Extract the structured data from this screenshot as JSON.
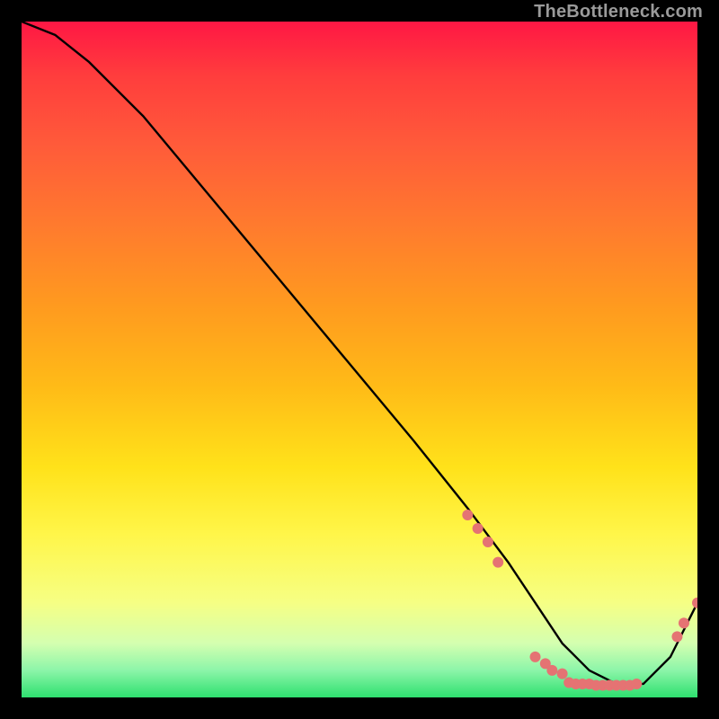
{
  "attribution": "TheBottleneck.com",
  "chart_data": {
    "type": "line",
    "title": "",
    "xlabel": "",
    "ylabel": "",
    "xlim": [
      0,
      100
    ],
    "ylim": [
      0,
      100
    ],
    "background_gradient": [
      "#ff1744",
      "#ff9a1f",
      "#fff64a",
      "#2ee06f"
    ],
    "series": [
      {
        "name": "bottleneck-curve",
        "color": "#000000",
        "x": [
          0,
          5,
          10,
          18,
          28,
          38,
          48,
          58,
          66,
          72,
          76,
          80,
          84,
          88,
          92,
          96,
          100
        ],
        "values": [
          100,
          98,
          94,
          86,
          74,
          62,
          50,
          38,
          28,
          20,
          14,
          8,
          4,
          2,
          2,
          6,
          14
        ]
      }
    ],
    "markers": [
      {
        "name": "descent-cluster",
        "color": "#e57373",
        "points": [
          {
            "x": 66,
            "y": 27
          },
          {
            "x": 67.5,
            "y": 25
          },
          {
            "x": 69,
            "y": 23
          },
          {
            "x": 70.5,
            "y": 20
          }
        ]
      },
      {
        "name": "valley-left-cluster",
        "color": "#e57373",
        "points": [
          {
            "x": 76,
            "y": 6
          },
          {
            "x": 77.5,
            "y": 5
          },
          {
            "x": 78.5,
            "y": 4
          },
          {
            "x": 80,
            "y": 3.5
          }
        ]
      },
      {
        "name": "valley-floor-cluster",
        "color": "#e57373",
        "points": [
          {
            "x": 81,
            "y": 2.2
          },
          {
            "x": 82,
            "y": 2
          },
          {
            "x": 83,
            "y": 2
          },
          {
            "x": 84,
            "y": 2
          },
          {
            "x": 85,
            "y": 1.8
          },
          {
            "x": 86,
            "y": 1.8
          },
          {
            "x": 87,
            "y": 1.8
          },
          {
            "x": 88,
            "y": 1.8
          },
          {
            "x": 89,
            "y": 1.8
          },
          {
            "x": 90,
            "y": 1.8
          },
          {
            "x": 91,
            "y": 2
          }
        ]
      },
      {
        "name": "rise-cluster",
        "color": "#e57373",
        "points": [
          {
            "x": 97,
            "y": 9
          },
          {
            "x": 98,
            "y": 11
          },
          {
            "x": 100,
            "y": 14
          }
        ]
      }
    ]
  }
}
